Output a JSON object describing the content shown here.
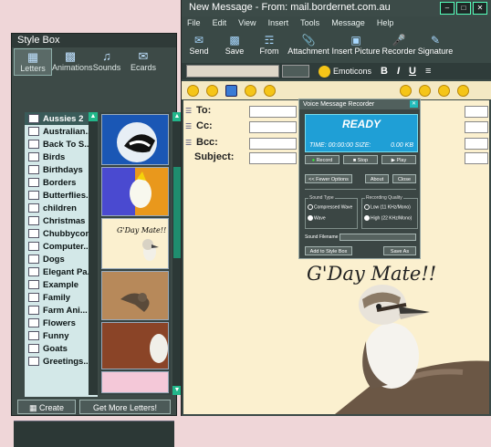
{
  "stylebox": {
    "title": "Style Box",
    "tabs": [
      {
        "label": "Letters",
        "icon": "letters-icon"
      },
      {
        "label": "Animations",
        "icon": "animations-icon"
      },
      {
        "label": "Sounds",
        "icon": "sounds-icon"
      },
      {
        "label": "Ecards",
        "icon": "ecards-icon"
      }
    ],
    "categories": [
      "Aussies 2",
      "Australian...",
      "Back To S...",
      "Birds",
      "Birthdays",
      "Borders",
      "Butterflies...",
      "children",
      "Christmas",
      "Chubbycons",
      "Computer...",
      "Dogs",
      "Elegant Pa...",
      "Example",
      "Family",
      "Farm Ani...",
      "Flowers",
      "Funny",
      "Goats",
      "Greetings..."
    ],
    "selected_category": "Aussies 2",
    "thumbnail_card_text": "G'Day Mate!!",
    "create_label": "Create",
    "get_more_label": "Get More Letters!"
  },
  "compose": {
    "title": "New Message - From: mail.bordernet.com.au",
    "menu": [
      "File",
      "Edit",
      "View",
      "Insert",
      "Tools",
      "Message",
      "Help"
    ],
    "toolbar": [
      {
        "label": "Send",
        "icon": "send-icon"
      },
      {
        "label": "Save",
        "icon": "save-icon"
      },
      {
        "label": "From",
        "icon": "from-icon"
      },
      {
        "label": "Attachment",
        "icon": "attachment-icon"
      },
      {
        "label": "Insert Picture",
        "icon": "insert-picture-icon"
      },
      {
        "label": "Recorder",
        "icon": "recorder-icon"
      },
      {
        "label": "Signature",
        "icon": "signature-icon"
      }
    ],
    "emoticons_label": "Emoticons",
    "format_buttons": [
      "B",
      "I",
      "U"
    ],
    "headers": [
      {
        "label": "To:",
        "value": ""
      },
      {
        "label": "Cc:",
        "value": ""
      },
      {
        "label": "Bcc:",
        "value": ""
      },
      {
        "label": "Subject:",
        "value": ""
      }
    ],
    "letter_text": "G'Day Mate!!"
  },
  "voice_recorder": {
    "title": "Voice Message Recorder",
    "status": "READY",
    "time_label": "TIME: 00:00:00 SIZE:",
    "size_value": "0.00 KB",
    "buttons": {
      "record": "Record",
      "stop": "Stop",
      "play": "Play",
      "fewer_options": "<< Fewer Options",
      "about": "About",
      "close": "Close",
      "add_to_style_box": "Add to Style Box",
      "save_as": "Save As"
    },
    "sound_type_label": "Sound Type",
    "sound_type_options": [
      "Compressed Wave",
      "Wave"
    ],
    "recording_quality_label": "Recording Quality",
    "recording_quality_options": [
      "Low (11 KHz/Mono)",
      "High (22 KHz/Mono)"
    ],
    "sound_filename_label": "Sound Filename"
  }
}
